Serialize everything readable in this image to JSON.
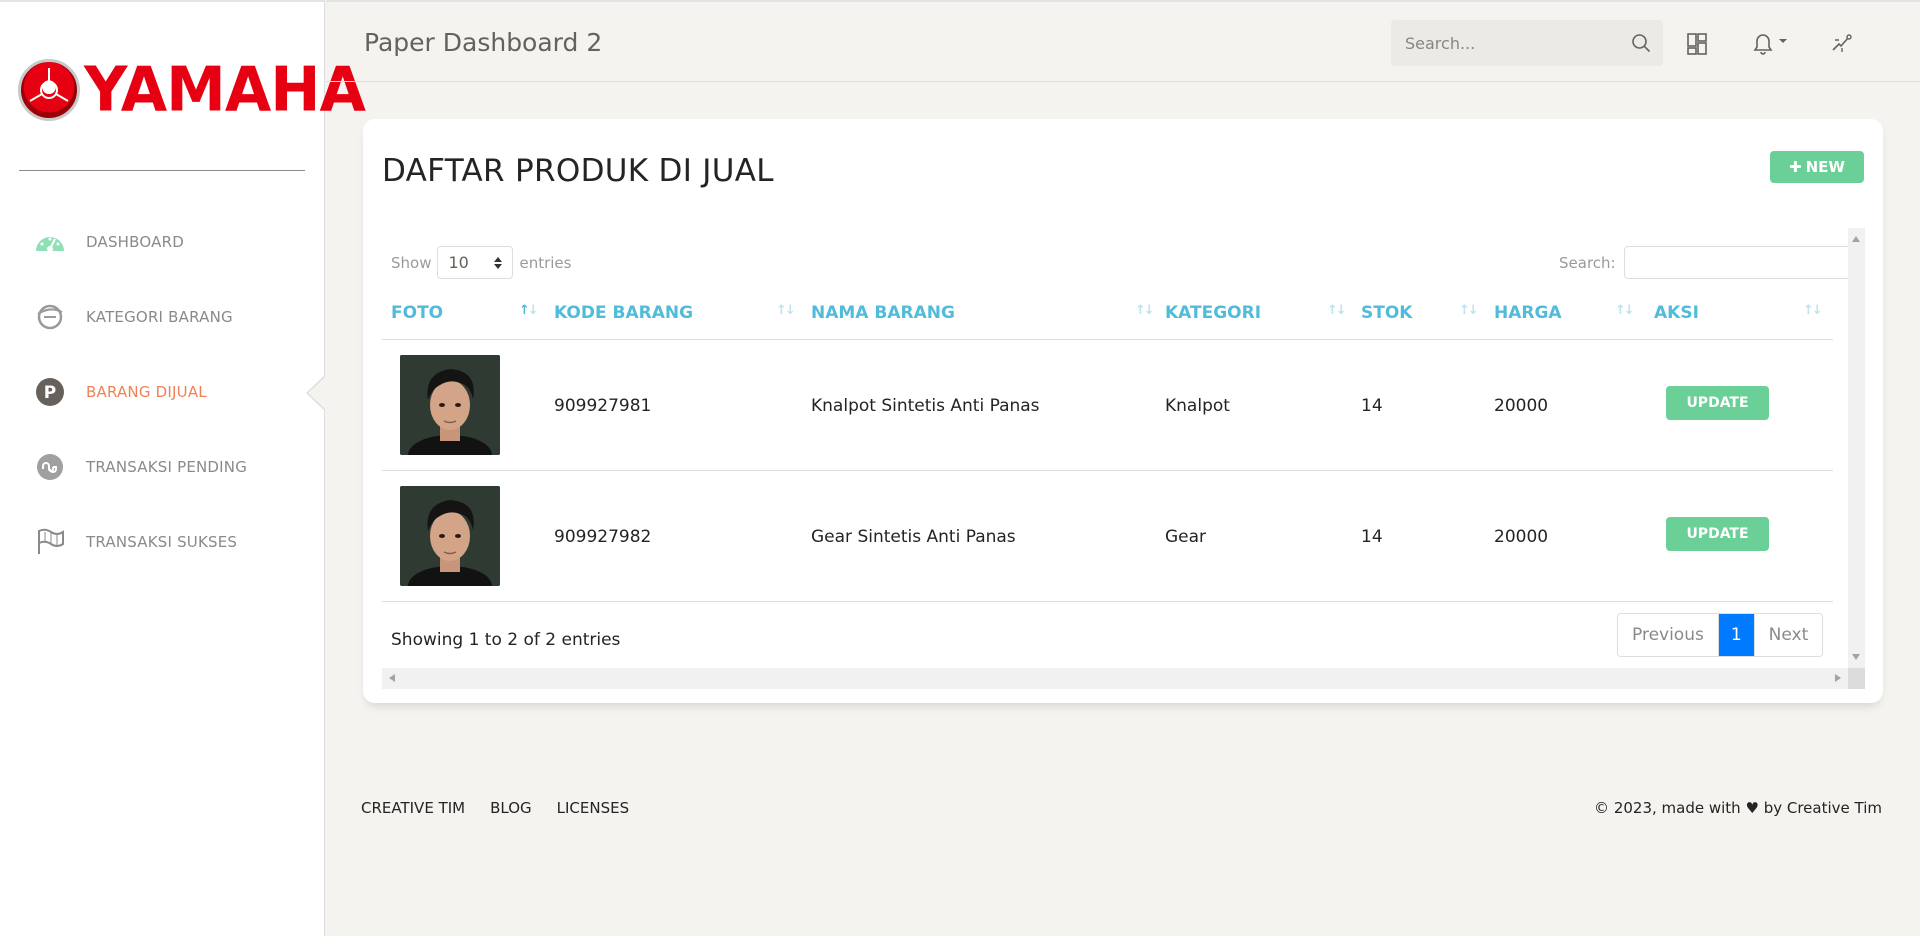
{
  "brand": {
    "logo_text": "YAMAHA"
  },
  "sidebar": {
    "items": [
      {
        "label": "DASHBOARD",
        "icon": "dashboard-gauge-icon",
        "color": "#8fe0b6"
      },
      {
        "label": "KATEGORI BARANG",
        "icon": "explorer-e-icon",
        "color": "#8a8a8a"
      },
      {
        "label": "BARANG DIJUAL",
        "icon": "parking-p-icon",
        "color": "#66615b",
        "active": true
      },
      {
        "label": "TRANSAKSI PENDING",
        "icon": "stumbleupon-icon",
        "color": "#a0a0a0"
      },
      {
        "label": "TRANSAKSI SUKSES",
        "icon": "flag-icon",
        "color": "#8a8a8a"
      }
    ]
  },
  "navbar": {
    "title": "Paper Dashboard 2",
    "search_placeholder": "Search..."
  },
  "card": {
    "title": "DAFTAR PRODUK DI JUAL",
    "new_button": "NEW"
  },
  "table": {
    "show_label": "Show",
    "entries_label": "entries",
    "length_value": "10",
    "search_label": "Search:",
    "columns": [
      "FOTO",
      "KODE BARANG",
      "NAMA BARANG",
      "KATEGORI",
      "STOK",
      "HARGA",
      "AKSI"
    ],
    "rows": [
      {
        "kode": "909927981",
        "nama": "Knalpot Sintetis Anti Panas",
        "kategori": "Knalpot",
        "stok": "14",
        "harga": "20000",
        "aksi": "UPDATE"
      },
      {
        "kode": "909927982",
        "nama": "Gear Sintetis Anti Panas",
        "kategori": "Gear",
        "stok": "14",
        "harga": "20000",
        "aksi": "UPDATE"
      }
    ],
    "info": "Showing 1 to 2 of 2 entries",
    "pagination": {
      "previous": "Previous",
      "current": "1",
      "next": "Next"
    }
  },
  "footer": {
    "links": [
      "CREATIVE TIM",
      "BLOG",
      "LICENSES"
    ],
    "copyright_prefix": "© 2023, made with",
    "copyright_suffix": "by Creative Tim"
  },
  "colors": {
    "accent_green": "#6bd098",
    "accent_cyan": "#51bcda",
    "active_orange": "#ef8157",
    "primary_blue": "#007bff"
  }
}
